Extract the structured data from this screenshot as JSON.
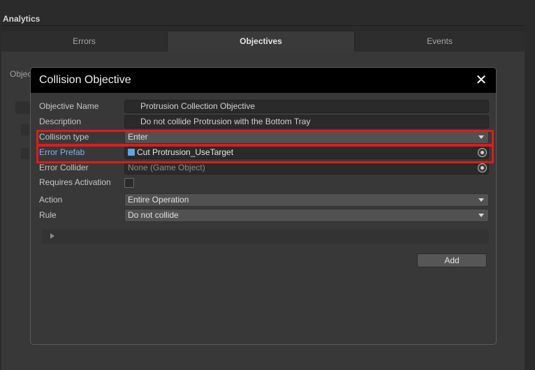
{
  "window": {
    "title": "Analytics"
  },
  "tabs": [
    {
      "label": "Errors",
      "active": false
    },
    {
      "label": "Objectives",
      "active": true
    },
    {
      "label": "Events",
      "active": false
    }
  ],
  "background": {
    "partial_label": "Objec"
  },
  "modal": {
    "title": "Collision Objective",
    "close_icon": "close-icon",
    "fields": {
      "objective_name": {
        "label": "Objective Name",
        "value": "Protrusion Collection Objective"
      },
      "description": {
        "label": "Description",
        "value": "Do not collide Protrusion with the Bottom Tray"
      },
      "collision_type": {
        "label": "Collision type",
        "value": "Enter"
      },
      "error_prefab": {
        "label": "Error Prefab",
        "value": "Cut Protrusion_UseTarget",
        "icon": "prefab-cube-icon"
      },
      "error_collider": {
        "label": "Error Collider",
        "value": "None (Game Object)"
      },
      "requires_activation": {
        "label": "Requires Activation",
        "checked": false
      },
      "action": {
        "label": "Action",
        "value": "Entire Operation"
      },
      "rule": {
        "label": "Rule",
        "value": "Do not collide"
      }
    },
    "add_label": "Add"
  },
  "colors": {
    "highlight": "#e01b1b",
    "link_label": "#7fb2ee",
    "prefab_icon": "#5aa7e8"
  }
}
